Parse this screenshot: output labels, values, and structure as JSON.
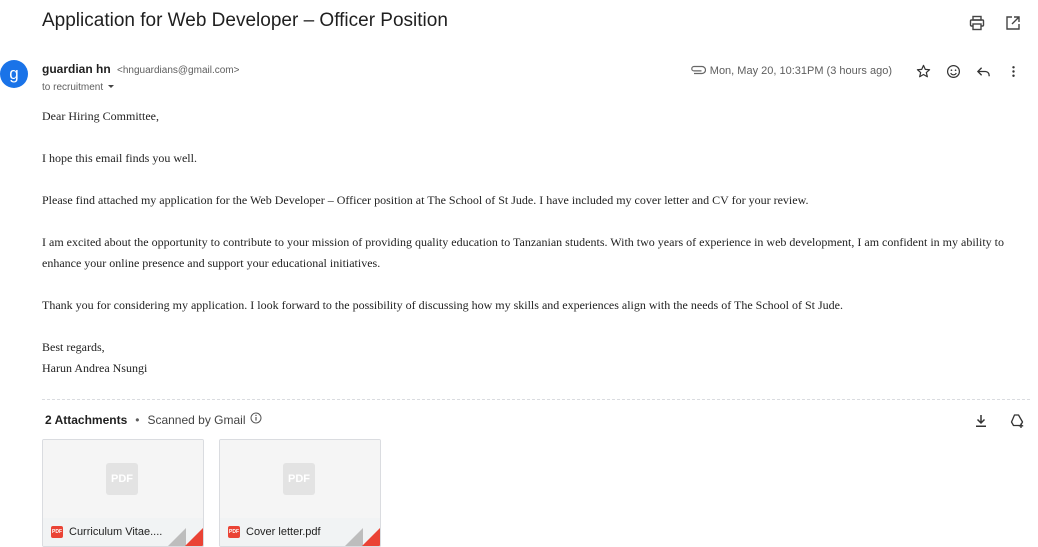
{
  "email": {
    "subject": "Application for Web Developer – Officer Position",
    "avatar_letter": "g",
    "sender_name": "guardian hn",
    "sender_email": "<hnguardians@gmail.com>",
    "recipient": "to recruitment",
    "date": "Mon, May 20, 10:31PM (3 hours ago)",
    "body": {
      "greeting": "Dear Hiring Committee,",
      "p1": "I hope this email finds you well.",
      "p2": "Please find attached my application for the Web Developer – Officer position at The School of St Jude. I have included my cover letter and CV for your review.",
      "p3": "I am excited about the opportunity to contribute to your mission of providing quality education to Tanzanian students. With two years of experience in web development, I am confident in my ability to enhance your online presence and support your educational initiatives.",
      "p4": "Thank you for considering my application. I look forward to the possibility of discussing how my skills and experiences align with the needs of The School of St Jude.",
      "closing": "Best regards,",
      "signature": "Harun Andrea Nsungi"
    }
  },
  "attachments": {
    "count_label": "2 Attachments",
    "separator": "•",
    "scanned_label": "Scanned by Gmail",
    "items": [
      {
        "thumb_label": "PDF",
        "badge": "PDF",
        "name": "Curriculum Vitae...."
      },
      {
        "thumb_label": "PDF",
        "badge": "PDF",
        "name": "Cover letter.pdf"
      }
    ]
  },
  "icons": {
    "print": "print-icon",
    "open_new": "open-in-new-window-icon",
    "attachment": "paperclip-icon",
    "star": "star-icon",
    "emoji": "emoji-icon",
    "reply": "reply-icon",
    "more": "more-vert-icon",
    "download_all": "download-icon",
    "save_drive": "add-to-drive-icon",
    "info": "info-icon",
    "dropdown": "chevron-down-icon"
  },
  "colors": {
    "avatar": "#1a73e8",
    "pdf_red": "#ea4335"
  }
}
